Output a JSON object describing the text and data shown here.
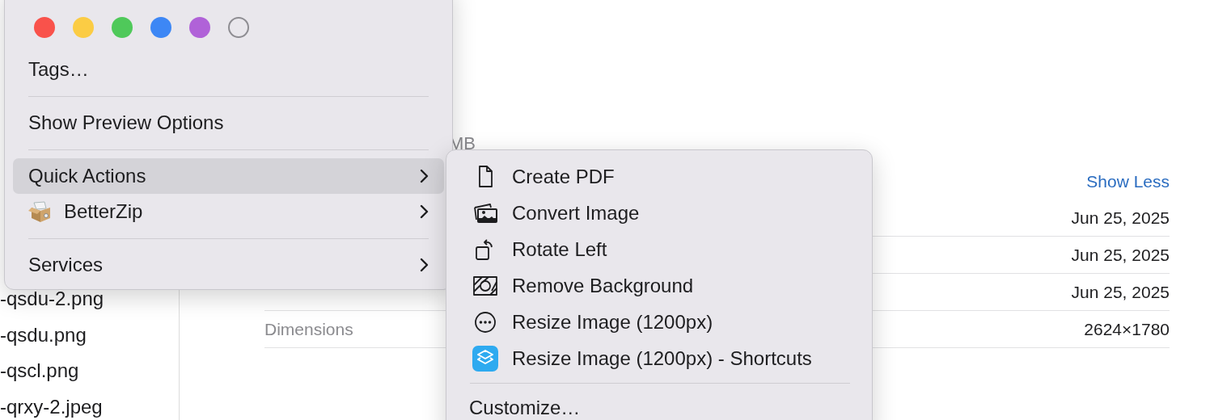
{
  "file_list": {
    "items": [
      {
        "name": "-qsdu-2.png"
      },
      {
        "name": "-qsdu.png"
      },
      {
        "name": "-qscl.png"
      },
      {
        "name": "-qrxy-2.jpeg"
      }
    ]
  },
  "info_panel": {
    "size_fragment": "MB",
    "toggle_link": "Show Less",
    "rows": [
      {
        "value": "Jun 25, 2025"
      },
      {
        "value": "Jun 25, 2025"
      },
      {
        "value": "Jun 25, 2025"
      },
      {
        "label": "Dimensions",
        "value": "2624×1780"
      }
    ]
  },
  "context_menu": {
    "tag_colors": [
      {
        "color": "#f9524b",
        "kind": "filled"
      },
      {
        "color": "#fbcc44",
        "kind": "filled"
      },
      {
        "color": "#4fc95a",
        "kind": "filled"
      },
      {
        "color": "#3d87f5",
        "kind": "filled"
      },
      {
        "color": "#b062d8",
        "kind": "filled"
      },
      {
        "color": "#8e8d92",
        "kind": "outline"
      }
    ],
    "items": [
      {
        "kind": "item",
        "label": "Tags…",
        "selected": false,
        "has_submenu": false
      },
      {
        "kind": "separator"
      },
      {
        "kind": "item",
        "label": "Show Preview Options",
        "selected": false,
        "has_submenu": false
      },
      {
        "kind": "separator"
      },
      {
        "kind": "item",
        "label": "Quick Actions",
        "selected": true,
        "has_submenu": true
      },
      {
        "kind": "app",
        "label": "BetterZip",
        "selected": false,
        "has_submenu": true
      },
      {
        "kind": "separator"
      },
      {
        "kind": "item",
        "label": "Services",
        "selected": false,
        "has_submenu": true
      }
    ]
  },
  "submenu": {
    "items": [
      {
        "kind": "document",
        "label": "Create PDF"
      },
      {
        "kind": "photos",
        "label": "Convert Image"
      },
      {
        "kind": "rotate",
        "label": "Rotate Left"
      },
      {
        "kind": "cutout",
        "label": "Remove Background"
      },
      {
        "kind": "workflow",
        "label": "Resize Image (1200px)"
      },
      {
        "kind": "shortcut",
        "label": "Resize Image (1200px) - Shortcuts"
      },
      {
        "kind": "separator"
      },
      {
        "kind": "item",
        "label": "Customize…"
      }
    ]
  }
}
